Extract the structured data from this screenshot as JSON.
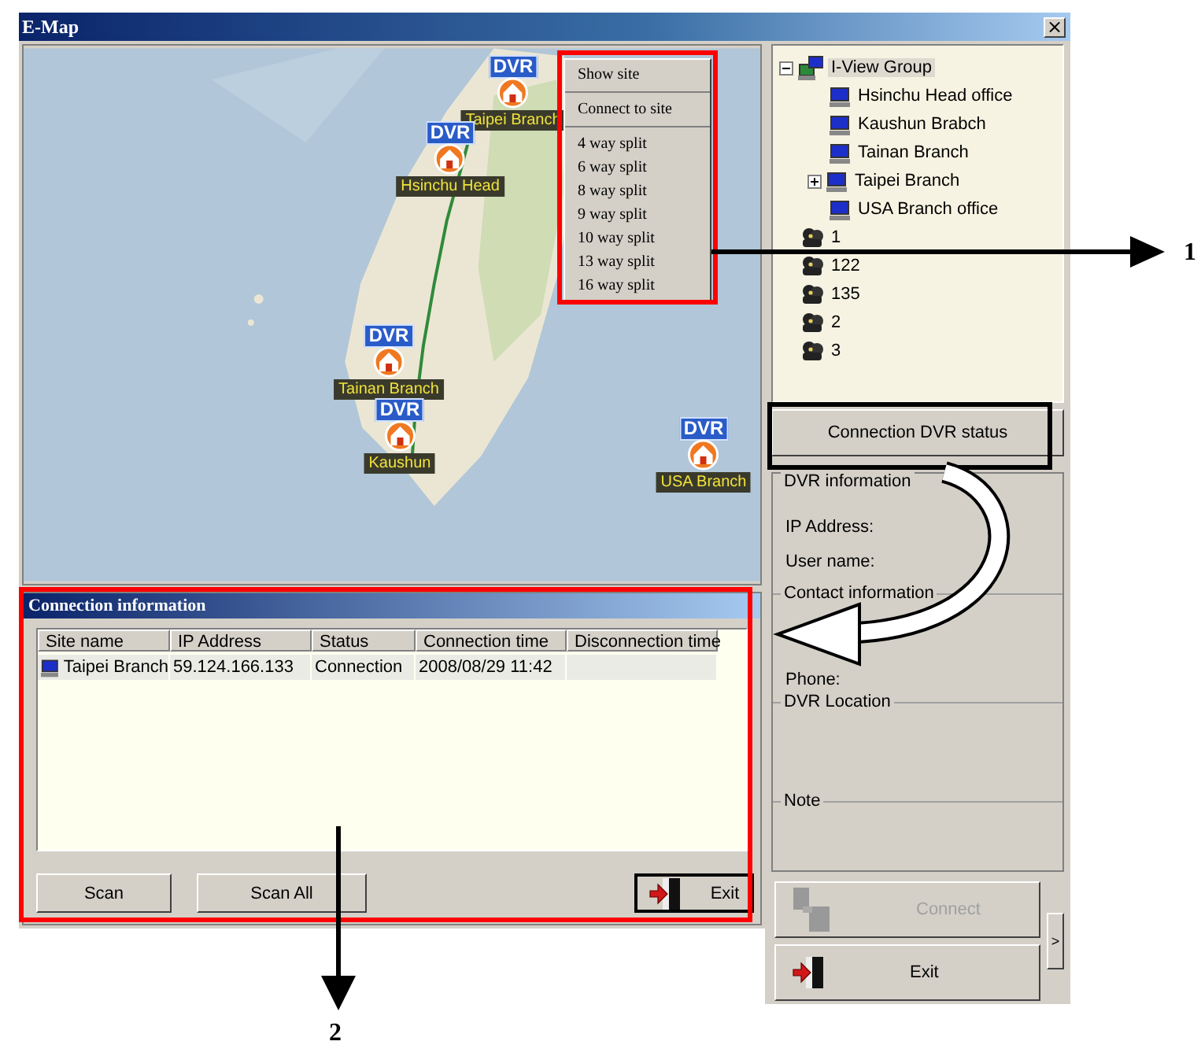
{
  "window": {
    "title": "E-Map",
    "close": "×"
  },
  "map": {
    "markers": [
      {
        "badge": "DVR",
        "label": "Taipei Branch"
      },
      {
        "badge": "DVR",
        "label": "Hsinchu Head"
      },
      {
        "badge": "DVR",
        "label": "Tainan Branch"
      },
      {
        "badge": "DVR",
        "label": "Kaushun"
      },
      {
        "badge": "DVR",
        "label": "USA Branch"
      }
    ]
  },
  "context_menu": {
    "items": [
      {
        "label": "Show site",
        "separator_after": true
      },
      {
        "label": "Connect to site",
        "separator_after": true
      },
      {
        "label": "4 way split",
        "separator_after": false
      },
      {
        "label": "6 way split",
        "separator_after": false
      },
      {
        "label": "8 way split",
        "separator_after": false
      },
      {
        "label": "9 way split",
        "separator_after": false
      },
      {
        "label": "10 way split",
        "separator_after": false
      },
      {
        "label": "13 way split",
        "separator_after": false
      },
      {
        "label": "16 way split",
        "separator_after": false
      }
    ]
  },
  "connection_info": {
    "title": "Connection information",
    "columns": [
      "Site name",
      "IP Address",
      "Status",
      "Connection time",
      "Disconnection time"
    ],
    "rows": [
      {
        "cells": [
          "Taipei Branch",
          "59.124.166.133",
          "Connection",
          "2008/08/29 11:42",
          ""
        ]
      }
    ],
    "buttons": [
      {
        "label": "Scan",
        "kind": "plain"
      },
      {
        "label": "Scan All",
        "kind": "plain"
      },
      {
        "label": "Exit",
        "kind": "exit"
      }
    ]
  },
  "tree": {
    "items": [
      {
        "label": "I-View Group",
        "kind": "network",
        "expanded": true,
        "selected": true,
        "children": [
          {
            "label": "Hsinchu Head office",
            "kind": "dvr",
            "selected": false
          },
          {
            "label": "Kaushun Brabch",
            "kind": "dvr",
            "selected": false
          },
          {
            "label": "Tainan Branch",
            "kind": "dvr",
            "selected": false
          },
          {
            "label": "Taipei Branch",
            "kind": "dvr",
            "expanded": false,
            "selected": false
          },
          {
            "label": "USA Branch office",
            "kind": "dvr",
            "selected": false
          }
        ]
      },
      {
        "label": "1",
        "kind": "group",
        "selected": false
      },
      {
        "label": "122",
        "kind": "group",
        "selected": false
      },
      {
        "label": "135",
        "kind": "group",
        "selected": false
      },
      {
        "label": "2",
        "kind": "group",
        "selected": false
      },
      {
        "label": "3",
        "kind": "group",
        "selected": false
      }
    ]
  },
  "status_button": "Connection DVR status",
  "dvr_info": {
    "sections": [
      {
        "title": "DVR information",
        "fields": [
          "IP Address:",
          "User name:"
        ]
      },
      {
        "title": "Contact information",
        "fields": [
          "Phone:"
        ]
      },
      {
        "title": "DVR Location"
      },
      {
        "title": "Note"
      }
    ]
  },
  "actions": [
    {
      "label": "Connect",
      "kind": "connect",
      "disabled": true
    },
    {
      "label": "Exit",
      "kind": "exit",
      "disabled": false
    }
  ],
  "expand_button": ">",
  "callouts": [
    {
      "label": "1"
    },
    {
      "label": "2"
    }
  ]
}
